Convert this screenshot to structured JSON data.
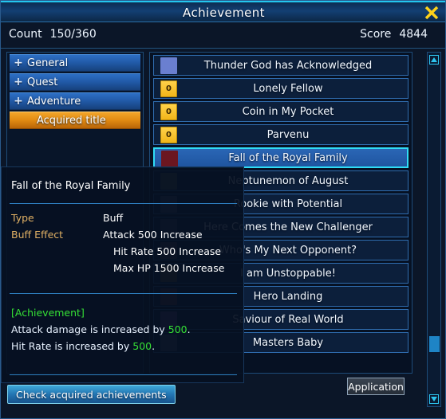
{
  "window": {
    "title": "Achievement",
    "close_icon": "close-x-icon"
  },
  "stats": {
    "count_label": "Count",
    "count_value": "150/360",
    "score_label": "Score",
    "score_value": "4844"
  },
  "sidebar": {
    "items": [
      {
        "label": "General",
        "expander": "+",
        "selected": false
      },
      {
        "label": "Quest",
        "expander": "+",
        "selected": false
      },
      {
        "label": "Adventure",
        "expander": "+",
        "selected": false
      },
      {
        "label": "Acquired title",
        "expander": "",
        "selected": true
      }
    ]
  },
  "achievements": {
    "rows": [
      {
        "label": "Thunder God has Acknowledged",
        "icon": "sprite-icon",
        "icon_color": "#6a7fd0",
        "selected": false
      },
      {
        "label": "Lonely Fellow",
        "icon": "coin-icon",
        "coin_value": "0",
        "selected": false
      },
      {
        "label": "Coin in My Pocket",
        "icon": "coin-icon",
        "coin_value": "0",
        "selected": false
      },
      {
        "label": "Parvenu",
        "icon": "coin-icon",
        "coin_value": "0",
        "selected": false
      },
      {
        "label": "Fall of the Royal Family",
        "icon": "crown-icon",
        "icon_color": "#6b1620",
        "selected": true
      },
      {
        "label": "Neptunemon of August",
        "icon": "stone-icon",
        "icon_color": "#5d6346",
        "selected": false
      },
      {
        "label": "Rookie with Potential",
        "icon": "medal-icon",
        "icon_color": "#4a5a78",
        "selected": false
      },
      {
        "label": "Here Comes the New Challenger",
        "icon": "medal-icon",
        "icon_color": "#41506b",
        "selected": false
      },
      {
        "label": "Who's My Next Opponent?",
        "icon": "medal-icon",
        "icon_color": "#5a4a58",
        "selected": false
      },
      {
        "label": "I am Unstoppable!",
        "icon": "medal-icon",
        "icon_color": "#6b5a30",
        "selected": false
      },
      {
        "label": "Hero Landing",
        "icon": "medal-icon",
        "icon_color": "#6b3a42",
        "selected": false
      },
      {
        "label": "Saviour of Real World",
        "icon": "orb-icon",
        "icon_color": "#6a4a8c",
        "selected": false
      },
      {
        "label": "Masters Baby",
        "icon": "medal-icon",
        "icon_color": "#4a5a78",
        "selected": false
      }
    ]
  },
  "tooltip": {
    "title": "Fall of the Royal Family",
    "type_label": "Type",
    "type_value": "Buff",
    "buff_label": "Buff Effect",
    "buff_effects": [
      "Attack 500 Increase",
      "Hit Rate 500 Increase",
      "Max HP 1500 Increase"
    ],
    "desc_heading": "[Achievement]",
    "desc_line1_pre": "Attack damage is increased by ",
    "desc_line1_num": "500",
    "desc_line1_post": ".",
    "desc_line2_pre": "Hit Rate is increased by ",
    "desc_line2_num": "500",
    "desc_line2_post": "."
  },
  "buttons": {
    "check_label": "Check acquired achievements",
    "application_label": "Application"
  },
  "scrollbar": {
    "up_icon": "triangle-up-icon",
    "down_icon": "triangle-down-icon"
  },
  "colors": {
    "accent_cyan": "#30dcf5",
    "selected_orange": "#e18a12",
    "green_text": "#35e035",
    "gold_label": "#e0b064"
  }
}
